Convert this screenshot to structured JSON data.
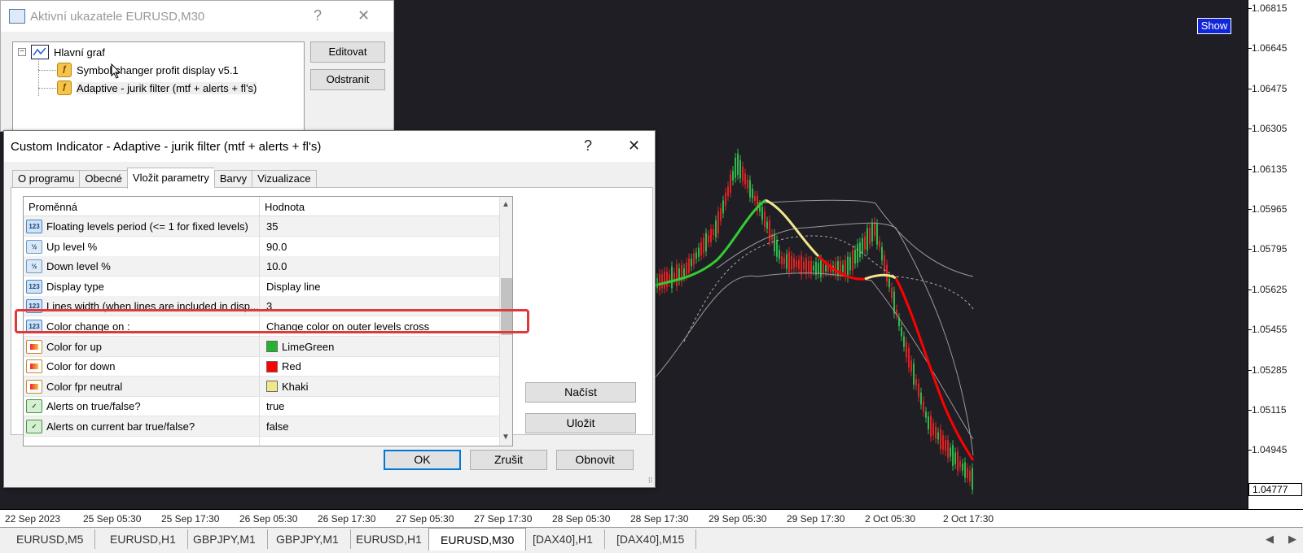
{
  "chart": {
    "show_label": "Show",
    "price_labels": [
      "1.06815",
      "1.06645",
      "1.06475",
      "1.06305",
      "1.06135",
      "1.05965",
      "1.05795",
      "1.05625",
      "1.05455",
      "1.05285",
      "1.05115",
      "1.04945"
    ],
    "current_price": "1.04777",
    "time_labels": [
      "22 Sep 2023",
      "25 Sep 05:30",
      "25 Sep 17:30",
      "26 Sep 05:30",
      "26 Sep 17:30",
      "27 Sep 05:30",
      "27 Sep 17:30",
      "28 Sep 05:30",
      "28 Sep 17:30",
      "29 Sep 05:30",
      "29 Sep 17:30",
      "2 Oct 05:30",
      "2 Oct 17:30"
    ],
    "colors": {
      "up": "#32cd32",
      "down": "#ff0000",
      "neutral": "#f0e68c",
      "background": "#201e25"
    }
  },
  "symbol_tabs": [
    "EURUSD,M5",
    "EURUSD,H1",
    "GBPJPY,M1",
    "GBPJPY,M1",
    "EURUSD,H1",
    "EURUSD,M30",
    "[DAX40],H1",
    "[DAX40],M15"
  ],
  "symbol_tab_active": "EURUSD,M30",
  "indicators_window": {
    "title": "Aktivní ukazatele EURUSD,M30",
    "help": "?",
    "close": "✕",
    "tree_root": "Hlavní graf",
    "tree_items": [
      "Symbol changer profit display v5.1",
      "Adaptive -  jurik filter (mtf + alerts + fl's)"
    ],
    "edit_button": "Editovat",
    "remove_button": "Odstranit"
  },
  "dialog": {
    "title": "Custom Indicator - Adaptive -  jurik filter (mtf + alerts + fl's)",
    "help": "?",
    "close": "✕",
    "tabs": [
      "O programu",
      "Obecné",
      "Vložit parametry",
      "Barvy",
      "Vizualizace"
    ],
    "active_tab": "Vložit parametry",
    "col_variable": "Proměnná",
    "col_value": "Hodnota",
    "rows": [
      {
        "type": "int",
        "name": "Floating levels period (<= 1 for fixed levels)",
        "value": "35"
      },
      {
        "type": "dbl",
        "name": "Up level %",
        "value": "90.0"
      },
      {
        "type": "dbl",
        "name": "Down level %",
        "value": "10.0"
      },
      {
        "type": "int",
        "name": "Display type",
        "value": "Display line"
      },
      {
        "type": "int",
        "name": "Lines width (when lines are included in disp...",
        "value": "3"
      },
      {
        "type": "int",
        "name": "Color change on :",
        "value": "Change color on outer levels cross"
      },
      {
        "type": "col",
        "name": "Color for up",
        "value": "LimeGreen",
        "color": "#22b42e"
      },
      {
        "type": "col",
        "name": "Color for down",
        "value": "Red",
        "color": "#ff0000"
      },
      {
        "type": "col",
        "name": "Color fpr neutral",
        "value": "Khaki",
        "color": "#f0e68c"
      },
      {
        "type": "bool",
        "name": "Alerts on true/false?",
        "value": "true"
      },
      {
        "type": "bool",
        "name": "Alerts on current bar true/false?",
        "value": "false"
      }
    ],
    "load_button": "Načíst",
    "save_button": "Uložit",
    "ok_button": "OK",
    "cancel_button": "Zrušit",
    "reset_button": "Obnovit"
  }
}
